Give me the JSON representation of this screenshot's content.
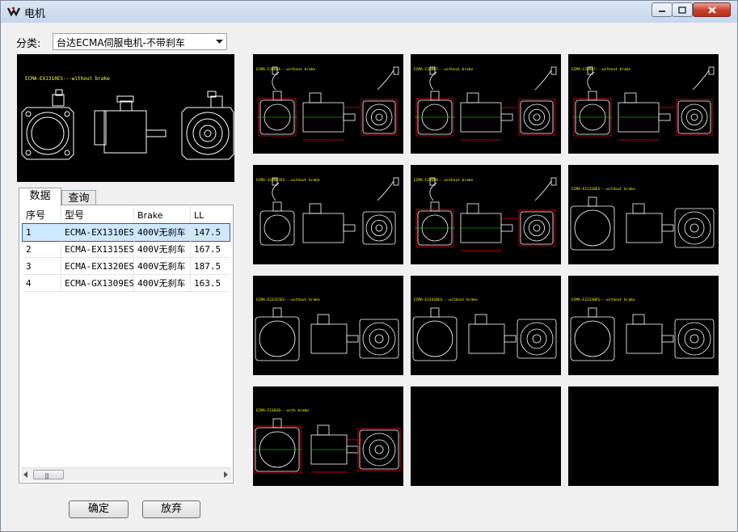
{
  "window": {
    "title": "电机",
    "controls": [
      "minimize-icon",
      "maximize-icon",
      "close-icon"
    ]
  },
  "category": {
    "label": "分类:",
    "selected": "台达ECMA伺服电机-不带刹车"
  },
  "preview": {
    "caption": "ECMA-EX1310ES---without brake"
  },
  "tabs": [
    {
      "label": "数据",
      "active": true
    },
    {
      "label": "查询",
      "active": false
    }
  ],
  "table": {
    "columns": [
      "序号",
      "型号",
      "Brake",
      "LL"
    ],
    "rows": [
      {
        "no": "1",
        "model": "ECMA-EX1310ES",
        "brake": "400V无刹车",
        "ll": "147.5",
        "selected": true
      },
      {
        "no": "2",
        "model": "ECMA-EX1315ES",
        "brake": "400V无刹车",
        "ll": "167.5",
        "selected": false
      },
      {
        "no": "3",
        "model": "ECMA-EX1320ES",
        "brake": "400V无刹车",
        "ll": "187.5",
        "selected": false
      },
      {
        "no": "4",
        "model": "ECMA-GX1309ES",
        "brake": "400V无刹车",
        "ll": "163.5",
        "selected": false
      }
    ]
  },
  "buttons": {
    "ok": "确定",
    "cancel": "放弃"
  },
  "thumbnails": [
    {
      "caption": "ECMA-C20604---without brake",
      "style": "red"
    },
    {
      "caption": "ECMA-C20807---without brake",
      "style": "red"
    },
    {
      "caption": "ECMA-C20807---without brake",
      "style": "red"
    },
    {
      "caption": "ECMA-J10807ES---without brake",
      "style": "plain"
    },
    {
      "caption": "ECMA-C20604---without brake",
      "style": "redsmall"
    },
    {
      "caption": "ECMA-E21310ES---without brake",
      "style": "large"
    },
    {
      "caption": "ECMA-E21315ES---without brake",
      "style": "large"
    },
    {
      "caption": "ECMA-E21320ES---without brake",
      "style": "large"
    },
    {
      "caption": "ECMA-E21330ES---without brake",
      "style": "large"
    },
    {
      "caption": "ECMA-F21820---with brake",
      "style": "redlarge"
    },
    {
      "caption": "",
      "style": "empty"
    },
    {
      "caption": "",
      "style": "empty"
    }
  ],
  "colors": {
    "drawing_bg": "#000000",
    "line": "#ffffff",
    "dimension": "#ff0000",
    "caption": "#ffff00",
    "center": "#00ff00",
    "selection": "#cde8ff"
  }
}
